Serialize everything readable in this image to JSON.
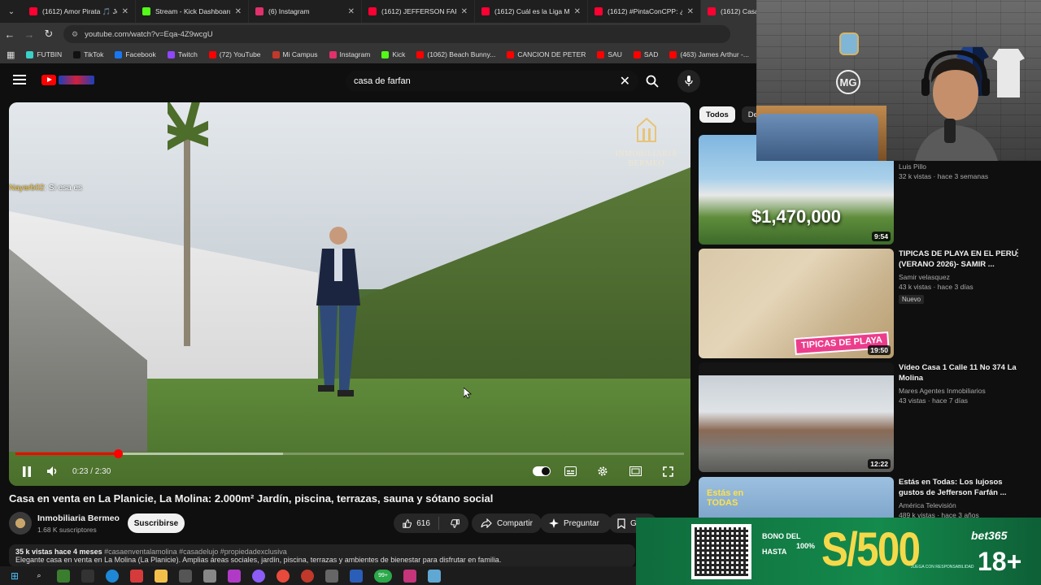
{
  "tabs": [
    {
      "title": "(1612) Amor Pirata 🎵 Je",
      "color": "#ff0033",
      "active": false
    },
    {
      "title": "Stream - Kick Dashboard",
      "color": "#53fc18",
      "active": false
    },
    {
      "title": "(6) Instagram",
      "color": "#e1306c",
      "active": false
    },
    {
      "title": "(1612) JEFFERSON FARFÁN",
      "color": "#ff0033",
      "active": false
    },
    {
      "title": "(1612) Cuál es la Liga Má",
      "color": "#ff0033",
      "active": false
    },
    {
      "title": "(1612) #PintaConCPP: ¿C",
      "color": "#ff0033",
      "active": false
    },
    {
      "title": "(1612) Casa en",
      "color": "#ff0033",
      "active": true
    }
  ],
  "address": {
    "url": "youtube.com/watch?v=Eqa-4Z9wcgU"
  },
  "bookmarks": [
    {
      "label": "FUTBIN",
      "color": "#3ad1c9"
    },
    {
      "label": "TikTok",
      "color": "#111111"
    },
    {
      "label": "Facebook",
      "color": "#1877f2"
    },
    {
      "label": "Twitch",
      "color": "#9146ff"
    },
    {
      "label": "(72) YouTube",
      "color": "#ff0000"
    },
    {
      "label": "Mi Campus",
      "color": "#c0392b"
    },
    {
      "label": "Instagram",
      "color": "#e1306c"
    },
    {
      "label": "Kick",
      "color": "#53fc18"
    },
    {
      "label": "(1062) Beach Bunny...",
      "color": "#ff0000"
    },
    {
      "label": "CANCION DE PETER",
      "color": "#ff0000"
    },
    {
      "label": "SAU",
      "color": "#ff0000"
    },
    {
      "label": "SAD",
      "color": "#ff0000"
    },
    {
      "label": "(463) James Arthur -...",
      "color": "#ff0000"
    },
    {
      "label": "DRAGON BAL",
      "color": "#ff0000"
    }
  ],
  "search": {
    "query": "casa de farfan"
  },
  "video": {
    "watermark_line1": "INMOBILIARIA",
    "watermark_line2": "BERMEO",
    "chat_user": "Nayarb02",
    "chat_msg": ": Si esa es",
    "time": "0:23 / 2:30",
    "progress": 0.153,
    "buffered": 0.4,
    "title": "Casa en venta en La Planicie, La Molina: 2.000m² Jardín, piscina, terrazas, sauna y sótano social"
  },
  "channel": {
    "name": "Inmobiliaria Bermeo",
    "subs": "1.68 K suscriptores",
    "subscribe_label": "Suscribirse"
  },
  "actions": {
    "likes": "616",
    "share": "Compartir",
    "ask": "Preguntar",
    "save": "G"
  },
  "description": {
    "meta": "35 k vistas  hace 4 meses",
    "tags": "#casaenventalamolina #casadelujo #propiedadexclusiva",
    "text": "Elegante casa en venta en La Molina (La Planicie). Amplias áreas sociales, jardín, piscina, terrazas y ambientes de bienestar para disfrutar en familia."
  },
  "chips": [
    "Todos",
    "De t"
  ],
  "recommendations": [
    {
      "title": "",
      "channel": "Luis Pillo",
      "views": "32 k vistas · hace 3 semanas",
      "duration": "9:54",
      "thumb_text": "$1,470,000"
    },
    {
      "title": "TIPICAS DE PLAYA EN EL PERU (VERANO 2026)- SAMIR ...",
      "channel": "Samir velasquez",
      "views": "43 k vistas · hace 3 días",
      "badge": "Nuevo",
      "duration": "19:50",
      "thumb_text": "TIPICAS DE PLAYA"
    },
    {
      "title": "Vídeo Casa 1 Calle 11 No 374 La Molina",
      "channel": "Mares Agentes Inmobiliarios",
      "views": "43 vistas · hace 7 días",
      "duration": "12:22"
    },
    {
      "title": "Estás en Todas: Los lujosos gustos de Jefferson Farfán ...",
      "channel": "América Televisión",
      "views": "489 k vistas · hace 3 años",
      "thumb_text": "Estás en TODAS"
    }
  ],
  "ad": {
    "bono_l1": "BONO DEL",
    "bono_l2": "HASTA",
    "pct": "100%",
    "amount": "S/500",
    "brand": "bet365",
    "age": "18+",
    "fine_print": "JUEGA CON RESPONSABILIDAD"
  },
  "cam": {
    "logo": "MG"
  }
}
